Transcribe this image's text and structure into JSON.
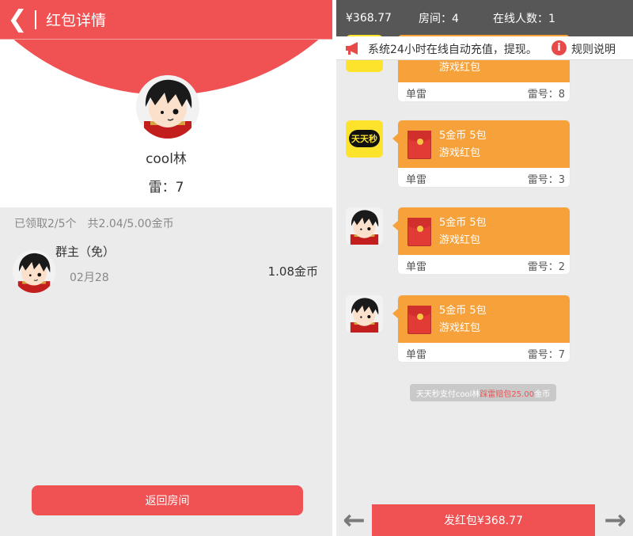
{
  "left": {
    "title": "红包详情",
    "back_icon": "chevron-left-icon",
    "user_name": "cool林",
    "mine_number": "雷：7",
    "received_summary": "已领取2/5个　共2.04/5.00金币",
    "records": [
      {
        "name": "群主（免）",
        "date": "02月28",
        "amount": "1.08金币"
      }
    ],
    "return_button": "返回房间",
    "colors": {
      "accent": "#f05253",
      "background": "#ebebeb"
    }
  },
  "right": {
    "status": {
      "balance": "¥368.77",
      "room": "房间：4",
      "online": "在线人数：1"
    },
    "notice": {
      "icon": "megaphone-icon",
      "text": "系统24小时在线自动充值，提现。",
      "info_icon": "info-icon",
      "rules": "规则说明"
    },
    "messages": [
      {
        "avatar": "tiantianmiao-logo",
        "coins": "",
        "type": "游戏红包",
        "single": "单雷",
        "mine": "雷号：8"
      },
      {
        "avatar": "tiantianmiao-logo",
        "logo_text": "天天秒",
        "coins": "5金币 5包",
        "type": "游戏红包",
        "single": "单雷",
        "mine": "雷号：3"
      },
      {
        "avatar": "cartoon-boy-avatar",
        "coins": "5金币 5包",
        "type": "游戏红包",
        "single": "单雷",
        "mine": "雷号：2"
      },
      {
        "avatar": "cartoon-boy-avatar",
        "coins": "5金币 5包",
        "type": "游戏红包",
        "single": "单雷",
        "mine": "雷号：7"
      }
    ],
    "system_message": {
      "prefix": "天天秒支付cool林",
      "highlight": "踩雷赔包25.00",
      "suffix": "金币"
    },
    "bottom": {
      "prev_icon": "arrow-left-icon",
      "send_button": "发红包¥368.77",
      "next_icon": "arrow-right-icon"
    },
    "colors": {
      "status_bar": "#575757",
      "bubble": "#f7a13a",
      "accent": "#f05253"
    }
  }
}
